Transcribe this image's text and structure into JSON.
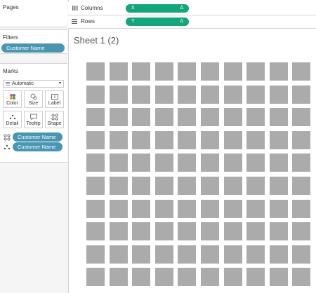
{
  "pages": {
    "title": "Pages"
  },
  "filters": {
    "title": "Filters",
    "pill": "Customer Name"
  },
  "marks": {
    "title": "Marks",
    "type": "Automatic",
    "buttons": [
      {
        "label": "Color",
        "icon": "color-icon"
      },
      {
        "label": "Size",
        "icon": "size-icon"
      },
      {
        "label": "Label",
        "icon": "label-icon"
      },
      {
        "label": "Detail",
        "icon": "detail-icon"
      },
      {
        "label": "Tooltip",
        "icon": "tooltip-icon"
      },
      {
        "label": "Shape",
        "icon": "shape-icon"
      }
    ],
    "fields": [
      {
        "label": "Customer Name",
        "icon": "shape-icon"
      },
      {
        "label": "Customer Name",
        "icon": "detail-icon"
      }
    ]
  },
  "columns": {
    "label": "Columns",
    "pill": "X",
    "delta": "Δ"
  },
  "rows": {
    "label": "Rows",
    "pill": "Y",
    "delta": "Δ"
  },
  "sheet": {
    "title": "Sheet 1 (2)"
  },
  "grid": {
    "rows": 10,
    "cols": 10,
    "cell_color": "#ababab"
  }
}
